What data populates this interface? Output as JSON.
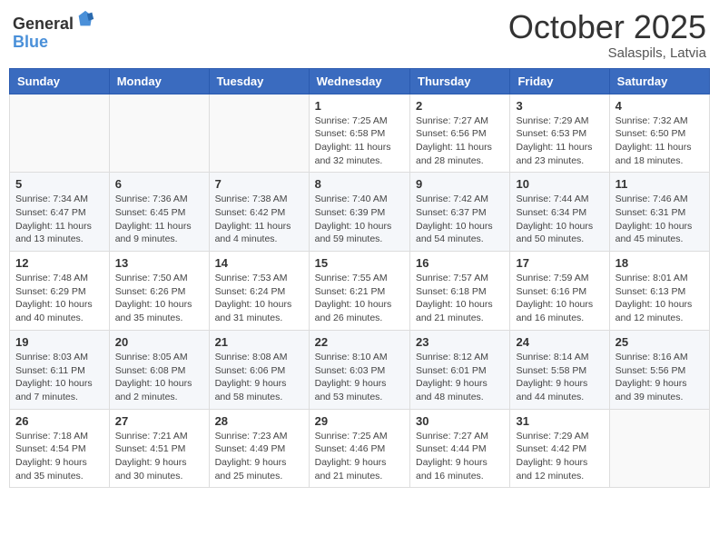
{
  "header": {
    "logo_general": "General",
    "logo_blue": "Blue",
    "month": "October 2025",
    "location": "Salaspils, Latvia"
  },
  "weekdays": [
    "Sunday",
    "Monday",
    "Tuesday",
    "Wednesday",
    "Thursday",
    "Friday",
    "Saturday"
  ],
  "weeks": [
    [
      {
        "day": "",
        "content": ""
      },
      {
        "day": "",
        "content": ""
      },
      {
        "day": "",
        "content": ""
      },
      {
        "day": "1",
        "content": "Sunrise: 7:25 AM\nSunset: 6:58 PM\nDaylight: 11 hours\nand 32 minutes."
      },
      {
        "day": "2",
        "content": "Sunrise: 7:27 AM\nSunset: 6:56 PM\nDaylight: 11 hours\nand 28 minutes."
      },
      {
        "day": "3",
        "content": "Sunrise: 7:29 AM\nSunset: 6:53 PM\nDaylight: 11 hours\nand 23 minutes."
      },
      {
        "day": "4",
        "content": "Sunrise: 7:32 AM\nSunset: 6:50 PM\nDaylight: 11 hours\nand 18 minutes."
      }
    ],
    [
      {
        "day": "5",
        "content": "Sunrise: 7:34 AM\nSunset: 6:47 PM\nDaylight: 11 hours\nand 13 minutes."
      },
      {
        "day": "6",
        "content": "Sunrise: 7:36 AM\nSunset: 6:45 PM\nDaylight: 11 hours\nand 9 minutes."
      },
      {
        "day": "7",
        "content": "Sunrise: 7:38 AM\nSunset: 6:42 PM\nDaylight: 11 hours\nand 4 minutes."
      },
      {
        "day": "8",
        "content": "Sunrise: 7:40 AM\nSunset: 6:39 PM\nDaylight: 10 hours\nand 59 minutes."
      },
      {
        "day": "9",
        "content": "Sunrise: 7:42 AM\nSunset: 6:37 PM\nDaylight: 10 hours\nand 54 minutes."
      },
      {
        "day": "10",
        "content": "Sunrise: 7:44 AM\nSunset: 6:34 PM\nDaylight: 10 hours\nand 50 minutes."
      },
      {
        "day": "11",
        "content": "Sunrise: 7:46 AM\nSunset: 6:31 PM\nDaylight: 10 hours\nand 45 minutes."
      }
    ],
    [
      {
        "day": "12",
        "content": "Sunrise: 7:48 AM\nSunset: 6:29 PM\nDaylight: 10 hours\nand 40 minutes."
      },
      {
        "day": "13",
        "content": "Sunrise: 7:50 AM\nSunset: 6:26 PM\nDaylight: 10 hours\nand 35 minutes."
      },
      {
        "day": "14",
        "content": "Sunrise: 7:53 AM\nSunset: 6:24 PM\nDaylight: 10 hours\nand 31 minutes."
      },
      {
        "day": "15",
        "content": "Sunrise: 7:55 AM\nSunset: 6:21 PM\nDaylight: 10 hours\nand 26 minutes."
      },
      {
        "day": "16",
        "content": "Sunrise: 7:57 AM\nSunset: 6:18 PM\nDaylight: 10 hours\nand 21 minutes."
      },
      {
        "day": "17",
        "content": "Sunrise: 7:59 AM\nSunset: 6:16 PM\nDaylight: 10 hours\nand 16 minutes."
      },
      {
        "day": "18",
        "content": "Sunrise: 8:01 AM\nSunset: 6:13 PM\nDaylight: 10 hours\nand 12 minutes."
      }
    ],
    [
      {
        "day": "19",
        "content": "Sunrise: 8:03 AM\nSunset: 6:11 PM\nDaylight: 10 hours\nand 7 minutes."
      },
      {
        "day": "20",
        "content": "Sunrise: 8:05 AM\nSunset: 6:08 PM\nDaylight: 10 hours\nand 2 minutes."
      },
      {
        "day": "21",
        "content": "Sunrise: 8:08 AM\nSunset: 6:06 PM\nDaylight: 9 hours\nand 58 minutes."
      },
      {
        "day": "22",
        "content": "Sunrise: 8:10 AM\nSunset: 6:03 PM\nDaylight: 9 hours\nand 53 minutes."
      },
      {
        "day": "23",
        "content": "Sunrise: 8:12 AM\nSunset: 6:01 PM\nDaylight: 9 hours\nand 48 minutes."
      },
      {
        "day": "24",
        "content": "Sunrise: 8:14 AM\nSunset: 5:58 PM\nDaylight: 9 hours\nand 44 minutes."
      },
      {
        "day": "25",
        "content": "Sunrise: 8:16 AM\nSunset: 5:56 PM\nDaylight: 9 hours\nand 39 minutes."
      }
    ],
    [
      {
        "day": "26",
        "content": "Sunrise: 7:18 AM\nSunset: 4:54 PM\nDaylight: 9 hours\nand 35 minutes."
      },
      {
        "day": "27",
        "content": "Sunrise: 7:21 AM\nSunset: 4:51 PM\nDaylight: 9 hours\nand 30 minutes."
      },
      {
        "day": "28",
        "content": "Sunrise: 7:23 AM\nSunset: 4:49 PM\nDaylight: 9 hours\nand 25 minutes."
      },
      {
        "day": "29",
        "content": "Sunrise: 7:25 AM\nSunset: 4:46 PM\nDaylight: 9 hours\nand 21 minutes."
      },
      {
        "day": "30",
        "content": "Sunrise: 7:27 AM\nSunset: 4:44 PM\nDaylight: 9 hours\nand 16 minutes."
      },
      {
        "day": "31",
        "content": "Sunrise: 7:29 AM\nSunset: 4:42 PM\nDaylight: 9 hours\nand 12 minutes."
      },
      {
        "day": "",
        "content": ""
      }
    ]
  ]
}
